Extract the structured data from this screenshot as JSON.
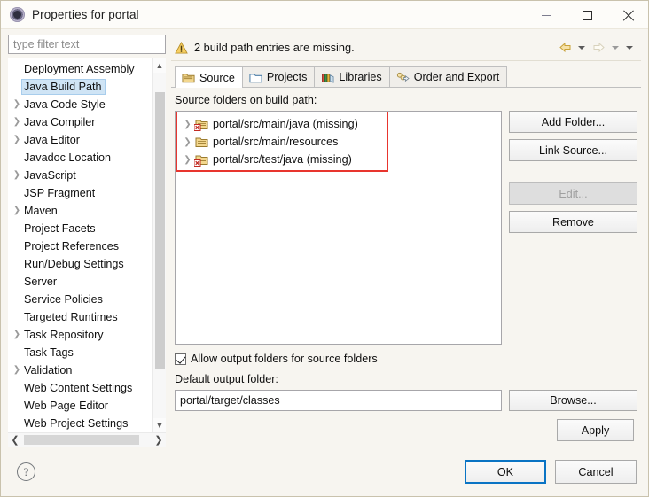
{
  "window": {
    "title": "Properties for portal",
    "icon": "properties-gear-icon",
    "controls": {
      "minimize": "minimize-icon",
      "maximize": "maximize-icon",
      "close": "close-icon"
    }
  },
  "sidebar": {
    "filter": {
      "placeholder": "type filter text",
      "value": ""
    },
    "items": [
      {
        "label": "Deployment Assembly",
        "expandable": false,
        "selected": false,
        "clipped": true
      },
      {
        "label": "Java Build Path",
        "expandable": false,
        "selected": true
      },
      {
        "label": "Java Code Style",
        "expandable": true,
        "selected": false
      },
      {
        "label": "Java Compiler",
        "expandable": true,
        "selected": false
      },
      {
        "label": "Java Editor",
        "expandable": true,
        "selected": false
      },
      {
        "label": "Javadoc Location",
        "expandable": false,
        "selected": false
      },
      {
        "label": "JavaScript",
        "expandable": true,
        "selected": false
      },
      {
        "label": "JSP Fragment",
        "expandable": false,
        "selected": false
      },
      {
        "label": "Maven",
        "expandable": true,
        "selected": false
      },
      {
        "label": "Project Facets",
        "expandable": false,
        "selected": false
      },
      {
        "label": "Project References",
        "expandable": false,
        "selected": false
      },
      {
        "label": "Run/Debug Settings",
        "expandable": false,
        "selected": false
      },
      {
        "label": "Server",
        "expandable": false,
        "selected": false
      },
      {
        "label": "Service Policies",
        "expandable": false,
        "selected": false
      },
      {
        "label": "Targeted Runtimes",
        "expandable": false,
        "selected": false
      },
      {
        "label": "Task Repository",
        "expandable": true,
        "selected": false
      },
      {
        "label": "Task Tags",
        "expandable": false,
        "selected": false
      },
      {
        "label": "Validation",
        "expandable": true,
        "selected": false
      },
      {
        "label": "Web Content Settings",
        "expandable": false,
        "selected": false
      },
      {
        "label": "Web Page Editor",
        "expandable": false,
        "selected": false
      },
      {
        "label": "Web Project Settings",
        "expandable": false,
        "selected": false
      }
    ]
  },
  "message_bar": {
    "icon": "warning-icon",
    "text": "2 build path entries are missing.",
    "back_icon": "back-arrow-icon",
    "back_menu_icon": "chevron-down-icon",
    "forward_icon": "forward-arrow-icon",
    "forward_menu_icon": "chevron-down-icon",
    "overflow_menu_icon": "chevron-down-icon"
  },
  "tabs": [
    {
      "label": "Source",
      "icon": "source-folder-icon",
      "active": true
    },
    {
      "label": "Projects",
      "icon": "projects-folder-icon",
      "active": false
    },
    {
      "label": "Libraries",
      "icon": "libraries-books-icon",
      "active": false
    },
    {
      "label": "Order and Export",
      "icon": "order-export-icon",
      "active": false
    }
  ],
  "source_tab": {
    "list_label": "Source folders on build path:",
    "entries": [
      {
        "path": "portal/src/main/java (missing)",
        "error": true
      },
      {
        "path": "portal/src/main/resources",
        "error": false
      },
      {
        "path": "portal/src/test/java (missing)",
        "error": true
      }
    ],
    "highlight_color": "#e8352e",
    "buttons": [
      {
        "label": "Add Folder...",
        "name": "add-folder-button",
        "disabled": false
      },
      {
        "label": "Link Source...",
        "name": "link-source-button",
        "disabled": false
      },
      {
        "label": "Edit...",
        "name": "edit-button",
        "disabled": true
      },
      {
        "label": "Remove",
        "name": "remove-button",
        "disabled": false
      }
    ],
    "allow_output_checkbox": {
      "label": "Allow output folders for source folders",
      "checked": true
    },
    "default_output_label": "Default output folder:",
    "default_output_value": "portal/target/classes",
    "browse_label": "Browse...",
    "apply_label": "Apply"
  },
  "footer": {
    "help_icon": "help-question-icon",
    "ok_label": "OK",
    "cancel_label": "Cancel"
  }
}
